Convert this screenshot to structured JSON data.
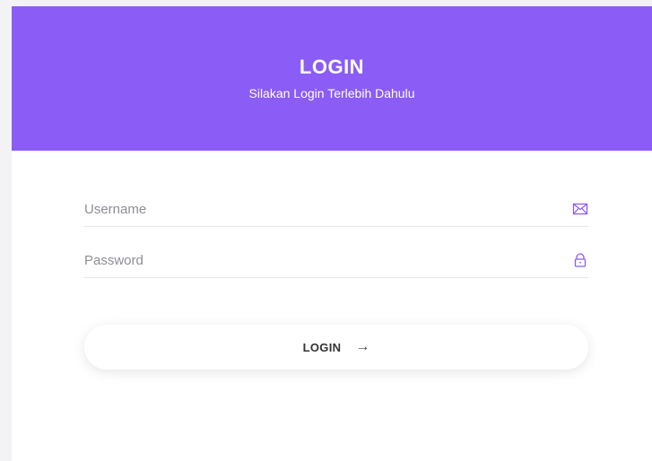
{
  "header": {
    "title": "LOGIN",
    "subtitle": "Silakan Login Terlebih Dahulu",
    "background_color": "#8b5cf6"
  },
  "form": {
    "username": {
      "placeholder": "Username",
      "value": "",
      "icon": "mail-icon"
    },
    "password": {
      "placeholder": "Password",
      "value": "",
      "icon": "lock-icon"
    }
  },
  "actions": {
    "login_label": "LOGIN",
    "arrow": "→"
  }
}
